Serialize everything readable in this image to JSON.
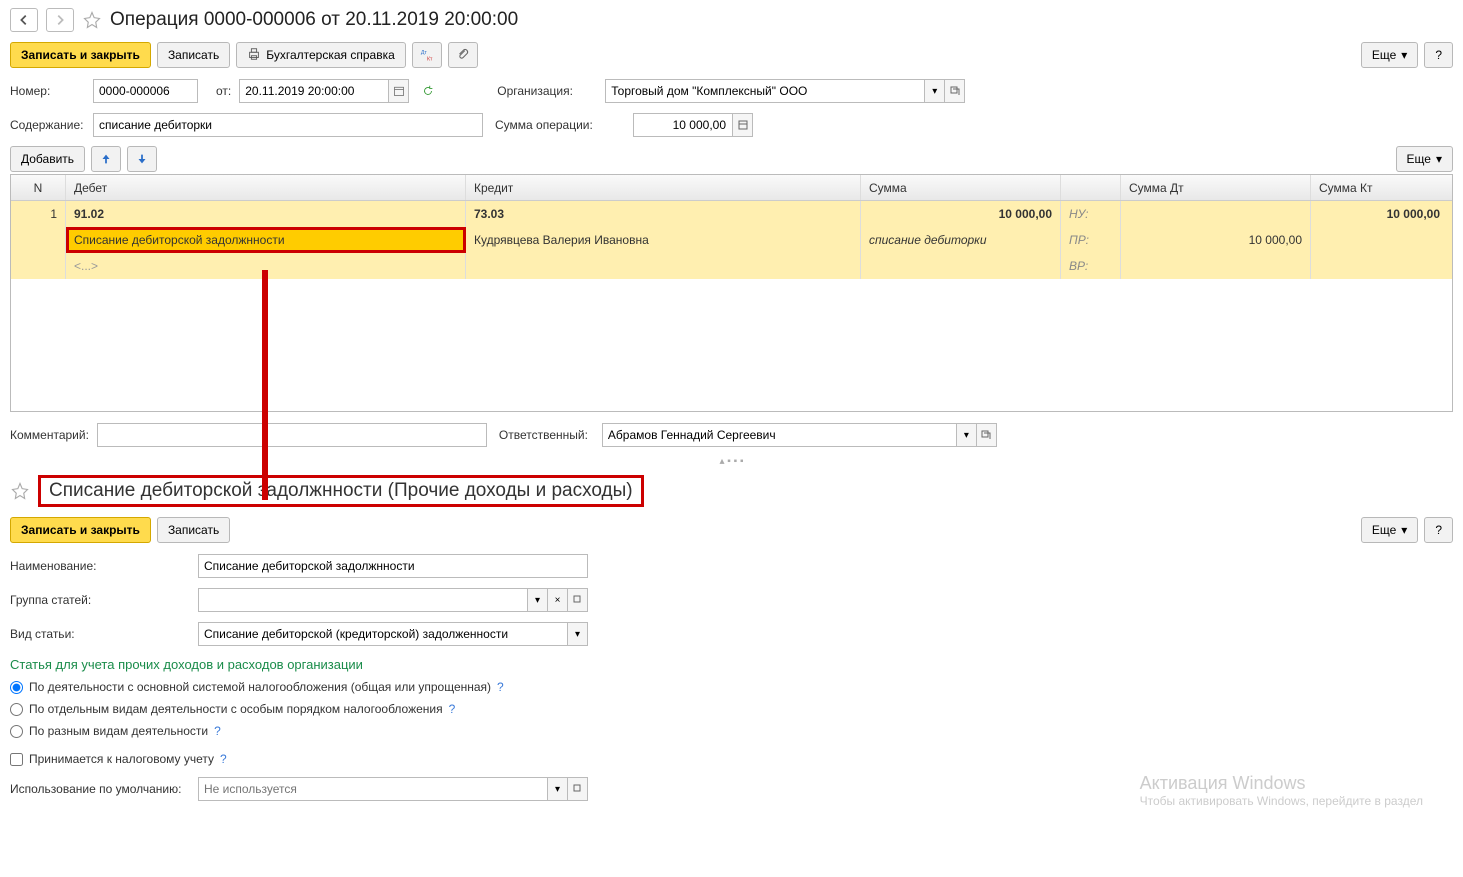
{
  "header": {
    "title": "Операция 0000-000006 от 20.11.2019 20:00:00"
  },
  "toolbar": {
    "save_close": "Записать и закрыть",
    "save": "Записать",
    "accounting_ref": "Бухгалтерская справка",
    "more": "Еще",
    "help": "?"
  },
  "fields": {
    "number_label": "Номер:",
    "number_value": "0000-000006",
    "from_label": "от:",
    "date_value": "20.11.2019 20:00:00",
    "org_label": "Организация:",
    "org_value": "Торговый дом \"Комплексный\" ООО",
    "content_label": "Содержание:",
    "content_value": "списание дебиторки",
    "sum_label": "Сумма операции:",
    "sum_value": "10 000,00",
    "comment_label": "Комментарий:",
    "comment_value": "",
    "responsible_label": "Ответственный:",
    "responsible_value": "Абрамов Геннадий Сергеевич"
  },
  "table_toolbar": {
    "add": "Добавить",
    "more": "Еще"
  },
  "table": {
    "headers": {
      "n": "N",
      "debet": "Дебет",
      "kredit": "Кредит",
      "summa": "Сумма",
      "sumdt": "Сумма Дт",
      "sumkt": "Сумма Кт"
    },
    "row1": {
      "n": "1",
      "debet_acc": "91.02",
      "kredit_acc": "73.03",
      "summa": "10 000,00",
      "tag1": "НУ:",
      "sumkt": "10 000,00"
    },
    "row2": {
      "debet_desc": "Списание дебиторской задолжнности",
      "kredit_desc": "Кудрявцева Валерия Ивановна",
      "summa_desc": "списание дебиторки",
      "tag2": "ПР:",
      "sumdt": "10 000,00"
    },
    "row3": {
      "debet_placeholder": "<...>",
      "tag3": "ВР:"
    }
  },
  "section2": {
    "title": "Списание дебиторской задолжнности (Прочие доходы и расходы)",
    "save_close": "Записать и закрыть",
    "save": "Записать",
    "more": "Еще",
    "help": "?",
    "name_label": "Наименование:",
    "name_value": "Списание дебиторской задолжнности",
    "group_label": "Группа статей:",
    "group_value": "",
    "type_label": "Вид статьи:",
    "type_value": "Списание дебиторской (кредиторской) задолженности",
    "heading": "Статья для учета прочих доходов и расходов организации",
    "radio1": "По деятельности с основной системой налогообложения (общая или упрощенная)",
    "radio2": "По отдельным видам деятельности с особым порядком налогообложения",
    "radio3": "По разным видам деятельности",
    "checkbox": "Принимается к налоговому учету",
    "default_label": "Использование по умолчанию:",
    "default_placeholder": "Не используется"
  },
  "watermark": {
    "line1": "Активация Windows",
    "line2": "Чтобы активировать Windows, перейдите в раздел"
  }
}
